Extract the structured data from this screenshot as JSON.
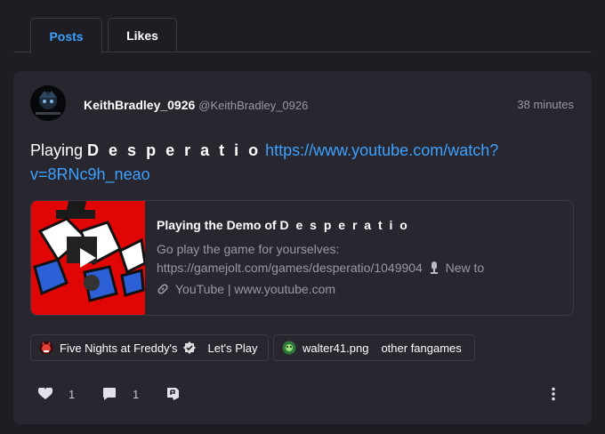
{
  "tabs": [
    {
      "label": "Posts",
      "active": true
    },
    {
      "label": "Likes",
      "active": false
    }
  ],
  "post": {
    "author_name": "KeithBradley_0926",
    "author_handle": "@KeithBradley_0926",
    "time_ago": "38 minutes",
    "text_prefix": "Playing ",
    "text_game": "D e s p e r a t i o",
    "text_link_line1": "https://www.youtube.com/watch?",
    "text_link_line2": "v=8RNc9h_neao",
    "embed": {
      "title_prefix": "Playing the Demo of ",
      "title_game": "D e s p e r a t i o",
      "desc_line1": "Go play the game for yourselves:",
      "desc_line2_a": "https://gamejolt.com/games/desperatio/1049904",
      "desc_line2_b": "New to",
      "source": "YouTube | www.youtube.com"
    },
    "tags": [
      {
        "name": "Five Nights at Freddy's",
        "extra": "Let's Play"
      },
      {
        "name": "walter41.png",
        "extra": "other fangames"
      }
    ],
    "likes": "1",
    "comments": "1"
  },
  "colors": {
    "background": "#1e1d24",
    "card": "#28272f",
    "accent": "#3ca1ff",
    "muted": "#9a99a2",
    "thumbnail_red": "#e00606"
  },
  "icons": [
    "heart-icon",
    "comment-icon",
    "share-icon",
    "more-vertical-icon",
    "link-icon",
    "microphone-icon",
    "verified-badge-icon",
    "play-icon"
  ]
}
